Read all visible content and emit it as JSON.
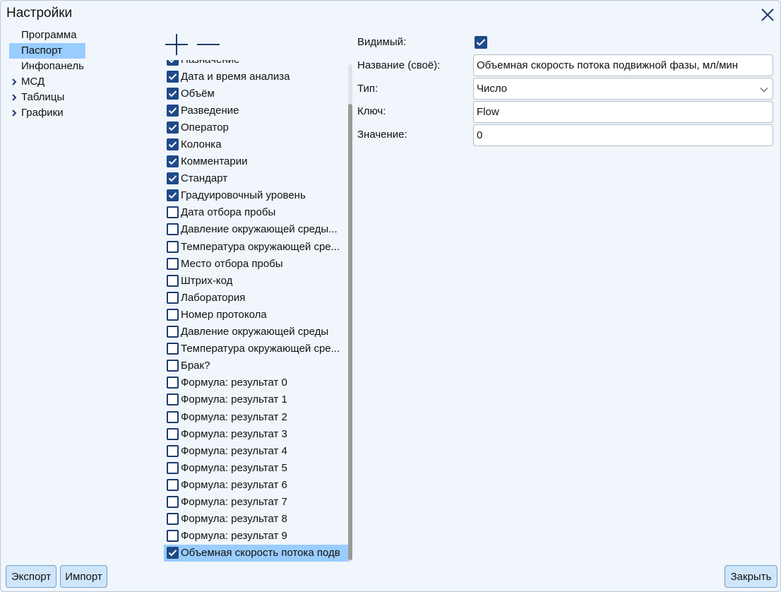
{
  "window": {
    "title": "Настройки"
  },
  "nav": {
    "items": [
      {
        "label": "Программа",
        "expandable": false,
        "selected": false
      },
      {
        "label": "Паспорт",
        "expandable": false,
        "selected": true
      },
      {
        "label": "Инфопанель",
        "expandable": false,
        "selected": false
      },
      {
        "label": "МСД",
        "expandable": true,
        "selected": false
      },
      {
        "label": "Таблицы",
        "expandable": true,
        "selected": false
      },
      {
        "label": "Графики",
        "expandable": true,
        "selected": false
      }
    ]
  },
  "list": {
    "items": [
      {
        "label": "Назначение",
        "checked": true,
        "selected": false
      },
      {
        "label": "Дата и время анализа",
        "checked": true,
        "selected": false
      },
      {
        "label": "Объём",
        "checked": true,
        "selected": false
      },
      {
        "label": "Разведение",
        "checked": true,
        "selected": false
      },
      {
        "label": "Оператор",
        "checked": true,
        "selected": false
      },
      {
        "label": "Колонка",
        "checked": true,
        "selected": false
      },
      {
        "label": "Комментарии",
        "checked": true,
        "selected": false
      },
      {
        "label": "Стандарт",
        "checked": true,
        "selected": false
      },
      {
        "label": "Градуировочный уровень",
        "checked": true,
        "selected": false
      },
      {
        "label": "Дата отбора пробы",
        "checked": false,
        "selected": false
      },
      {
        "label": "Давление окружающей среды...",
        "checked": false,
        "selected": false
      },
      {
        "label": "Температура окружающей сре...",
        "checked": false,
        "selected": false
      },
      {
        "label": "Место отбора пробы",
        "checked": false,
        "selected": false
      },
      {
        "label": "Штрих-код",
        "checked": false,
        "selected": false
      },
      {
        "label": "Лаборатория",
        "checked": false,
        "selected": false
      },
      {
        "label": "Номер протокола",
        "checked": false,
        "selected": false
      },
      {
        "label": "Давление окружающей среды",
        "checked": false,
        "selected": false
      },
      {
        "label": "Температура окружающей сре...",
        "checked": false,
        "selected": false
      },
      {
        "label": "Брак?",
        "checked": false,
        "selected": false
      },
      {
        "label": "Формула: результат 0",
        "checked": false,
        "selected": false
      },
      {
        "label": "Формула: результат 1",
        "checked": false,
        "selected": false
      },
      {
        "label": "Формула: результат 2",
        "checked": false,
        "selected": false
      },
      {
        "label": "Формула: результат 3",
        "checked": false,
        "selected": false
      },
      {
        "label": "Формула: результат 4",
        "checked": false,
        "selected": false
      },
      {
        "label": "Формула: результат 5",
        "checked": false,
        "selected": false
      },
      {
        "label": "Формула: результат 6",
        "checked": false,
        "selected": false
      },
      {
        "label": "Формула: результат 7",
        "checked": false,
        "selected": false
      },
      {
        "label": "Формула: результат 8",
        "checked": false,
        "selected": false
      },
      {
        "label": "Формула: результат 9",
        "checked": false,
        "selected": false
      },
      {
        "label": "Объемная скорость потока подв",
        "checked": true,
        "selected": true
      }
    ]
  },
  "properties": {
    "visible_label": "Видимый:",
    "visible_checked": true,
    "name_label": "Название (своё):",
    "name_value": "Объемная скорость потока подвижной фазы, мл/мин",
    "type_label": "Тип:",
    "type_value": "Число",
    "key_label": "Ключ:",
    "key_value": "Flow",
    "value_label": "Значение:",
    "value_value": "0"
  },
  "buttons": {
    "export_label": "Экспорт",
    "import_label": "Импорт",
    "close_label": "Закрыть"
  },
  "colors": {
    "accent_checkbox": "#1f4a8a",
    "selection": "#99ccff",
    "background": "#f0f6fb",
    "button_bg": "#cfe6fa"
  }
}
